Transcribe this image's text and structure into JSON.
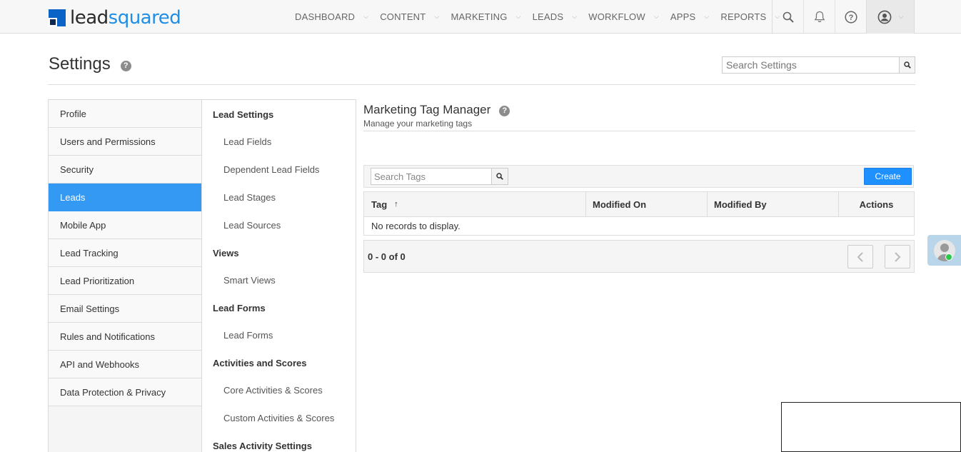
{
  "brand": {
    "logo_lead": "lead",
    "logo_squared": "squared",
    "colors": {
      "primary": "#1f8ee6",
      "active": "#3399f3",
      "button": "#1e90ff"
    }
  },
  "nav": {
    "items": [
      {
        "label": "DASHBOARD"
      },
      {
        "label": "CONTENT"
      },
      {
        "label": "MARKETING"
      },
      {
        "label": "LEADS"
      },
      {
        "label": "WORKFLOW"
      },
      {
        "label": "APPS"
      },
      {
        "label": "REPORTS"
      }
    ],
    "icons": [
      "search-icon",
      "bell-icon",
      "help-icon",
      "user-icon"
    ]
  },
  "header": {
    "title": "Settings",
    "help": "?",
    "search_placeholder": "Search Settings"
  },
  "sidebar": {
    "items": [
      {
        "label": "Profile"
      },
      {
        "label": "Users and Permissions"
      },
      {
        "label": "Security"
      },
      {
        "label": "Leads",
        "active": true
      },
      {
        "label": "Mobile App"
      },
      {
        "label": "Lead Tracking"
      },
      {
        "label": "Lead Prioritization"
      },
      {
        "label": "Email Settings"
      },
      {
        "label": "Rules and Notifications"
      },
      {
        "label": "API and Webhooks"
      },
      {
        "label": "Data Protection & Privacy"
      }
    ]
  },
  "submenu": {
    "sections": [
      {
        "title": "Lead Settings",
        "links": [
          "Lead Fields",
          "Dependent Lead Fields",
          "Lead Stages",
          "Lead Sources"
        ]
      },
      {
        "title": "Views",
        "links": [
          "Smart Views"
        ]
      },
      {
        "title": "Lead Forms",
        "links": [
          "Lead Forms"
        ]
      },
      {
        "title": "Activities and Scores",
        "links": [
          "Core Activities & Scores",
          "Custom Activities & Scores"
        ]
      },
      {
        "title": "Sales Activity Settings",
        "links": []
      }
    ]
  },
  "main": {
    "title": "Marketing Tag Manager",
    "help": "?",
    "subtitle": "Manage your marketing tags",
    "search_placeholder": "Search Tags",
    "create_label": "Create",
    "table": {
      "columns": [
        "Tag",
        "Modified On",
        "Modified By",
        "Actions"
      ],
      "sort_indicator": "↑",
      "empty_message": "No records to display."
    },
    "pager": {
      "info": "0 - 0 of 0",
      "prev": "‹",
      "next": "›"
    }
  }
}
